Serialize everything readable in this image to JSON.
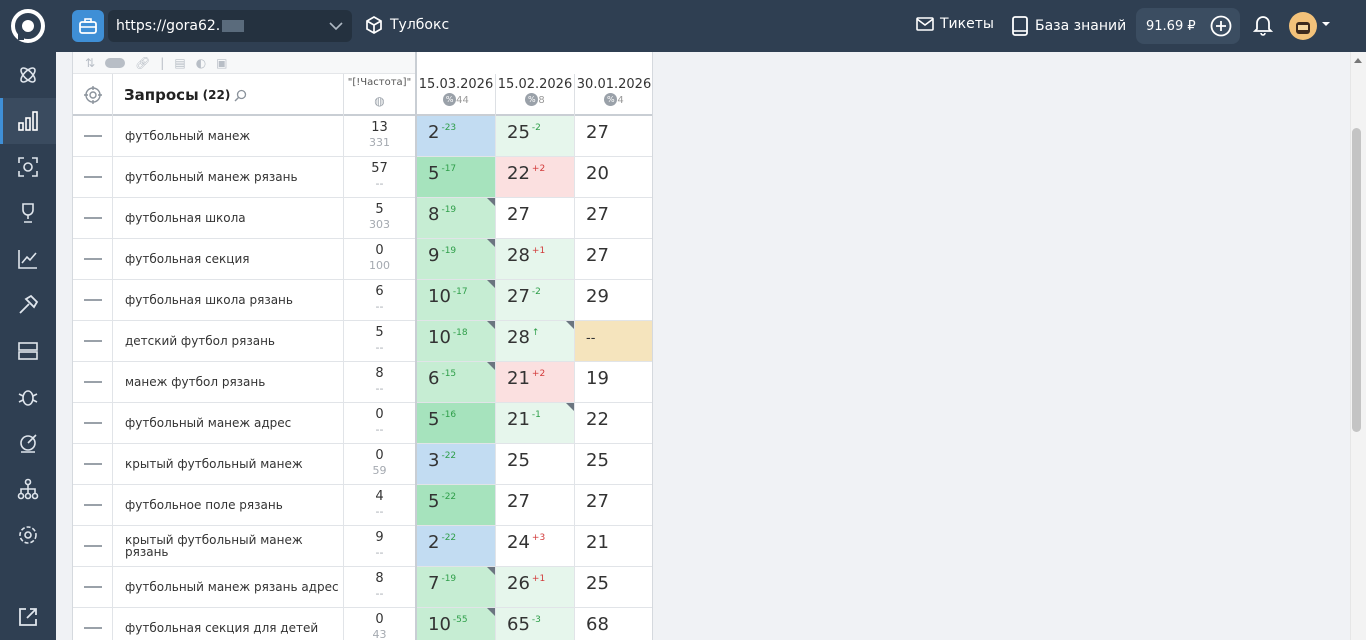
{
  "topbar": {
    "url": "https://gora62.",
    "tools_label": "Тулбокс",
    "tickets_label": "Тикеты",
    "kb_label": "База знаний",
    "balance": "91.69 ₽"
  },
  "table": {
    "title": "Запросы",
    "count": "(22)",
    "freq_header": "\"[!Частота]\"",
    "dates": [
      {
        "date": "15.03.2026",
        "pct": "44"
      },
      {
        "date": "15.02.2026",
        "pct": "8"
      },
      {
        "date": "30.01.2026",
        "pct": "4"
      }
    ],
    "rows": [
      {
        "query": "футбольный манеж",
        "f1": "13",
        "f2": "331",
        "p1": "2",
        "d1": "-23",
        "p2": "25",
        "d2": "-2",
        "p3": "27"
      },
      {
        "query": "футбольный манеж рязань",
        "f1": "57",
        "f2": "--",
        "p1": "5",
        "d1": "-17",
        "p2": "22",
        "d2": "+2",
        "p3": "20"
      },
      {
        "query": "футбольная школа",
        "f1": "5",
        "f2": "303",
        "p1": "8",
        "d1": "-19",
        "p2": "27",
        "d2": "",
        "p3": "27"
      },
      {
        "query": "футбольная секция",
        "f1": "0",
        "f2": "100",
        "p1": "9",
        "d1": "-19",
        "p2": "28",
        "d2": "+1",
        "p3": "27"
      },
      {
        "query": "футбольная школа рязань",
        "f1": "6",
        "f2": "--",
        "p1": "10",
        "d1": "-17",
        "p2": "27",
        "d2": "-2",
        "p3": "29"
      },
      {
        "query": "детский футбол рязань",
        "f1": "5",
        "f2": "--",
        "p1": "10",
        "d1": "-18",
        "p2": "28",
        "d2": "↑",
        "p3": "--"
      },
      {
        "query": "манеж футбол рязань",
        "f1": "8",
        "f2": "--",
        "p1": "6",
        "d1": "-15",
        "p2": "21",
        "d2": "+2",
        "p3": "19"
      },
      {
        "query": "футбольный манеж адрес",
        "f1": "0",
        "f2": "--",
        "p1": "5",
        "d1": "-16",
        "p2": "21",
        "d2": "-1",
        "p3": "22"
      },
      {
        "query": "крытый футбольный манеж",
        "f1": "0",
        "f2": "59",
        "p1": "3",
        "d1": "-22",
        "p2": "25",
        "d2": "",
        "p3": "25"
      },
      {
        "query": "футбольное поле рязань",
        "f1": "4",
        "f2": "--",
        "p1": "5",
        "d1": "-22",
        "p2": "27",
        "d2": "",
        "p3": "27"
      },
      {
        "query": "крытый футбольный манеж рязань",
        "f1": "9",
        "f2": "--",
        "p1": "2",
        "d1": "-22",
        "p2": "24",
        "d2": "+3",
        "p3": "21"
      },
      {
        "query": "футбольный манеж рязань адрес",
        "f1": "8",
        "f2": "--",
        "p1": "7",
        "d1": "-19",
        "p2": "26",
        "d2": "+1",
        "p3": "25"
      },
      {
        "query": "футбольная секция для детей",
        "f1": "0",
        "f2": "43",
        "p1": "10",
        "d1": "-55",
        "p2": "65",
        "d2": "-3",
        "p3": "68"
      }
    ]
  },
  "colors": {
    "blue_cell": "#c2dcf2",
    "green_dark": "#a6e3bd",
    "green_mid": "#c6edd3",
    "green_light": "#e6f6ec",
    "red_light": "#fbe0e0",
    "yellow": "#f5e4bd"
  }
}
